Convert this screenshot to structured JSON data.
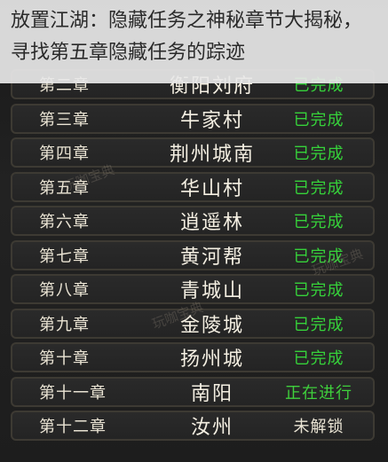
{
  "caption": {
    "text": "放置江湖：隐藏任务之神秘章节大揭秘，寻找第五章隐藏任务的踪迹"
  },
  "colors": {
    "status_done": "#36d23a",
    "status_in_progress": "#3fd03c",
    "status_locked": "#e9e3d3",
    "row_border": "#3d3a33"
  },
  "chapters": [
    {
      "chapter": "第二章",
      "place": "衡阳刘府",
      "status": "已完成",
      "state": "done"
    },
    {
      "chapter": "第三章",
      "place": "牛家村",
      "status": "已完成",
      "state": "done"
    },
    {
      "chapter": "第四章",
      "place": "荆州城南",
      "status": "已完成",
      "state": "done"
    },
    {
      "chapter": "第五章",
      "place": "华山村",
      "status": "已完成",
      "state": "done"
    },
    {
      "chapter": "第六章",
      "place": "逍遥林",
      "status": "已完成",
      "state": "done"
    },
    {
      "chapter": "第七章",
      "place": "黄河帮",
      "status": "已完成",
      "state": "done"
    },
    {
      "chapter": "第八章",
      "place": "青城山",
      "status": "已完成",
      "state": "done"
    },
    {
      "chapter": "第九章",
      "place": "金陵城",
      "status": "已完成",
      "state": "done"
    },
    {
      "chapter": "第十章",
      "place": "扬州城",
      "status": "已完成",
      "state": "done"
    },
    {
      "chapter": "第十一章",
      "place": "南阳",
      "status": "正在进行",
      "state": "progress"
    },
    {
      "chapter": "第十二章",
      "place": "汝州",
      "status": "未解锁",
      "state": "locked"
    }
  ],
  "watermarks": [
    "玩咖宝典",
    "玩咖宝典",
    "玩咖宝典"
  ]
}
